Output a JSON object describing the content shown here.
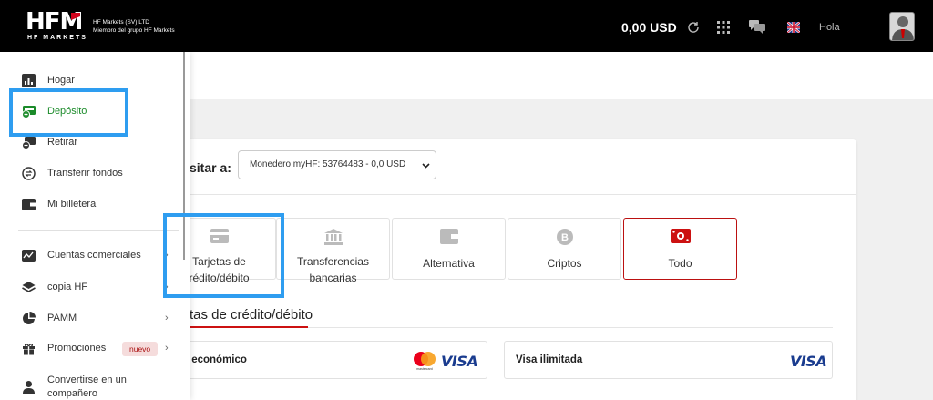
{
  "header": {
    "logo_text": "HFM",
    "logo_subtext": "HF MARKETS",
    "company_line1": "HF Markets (SV) LTD",
    "company_line2": "Miembro del grupo HF Markets",
    "balance": "0,00 USD",
    "greeting": "Hola"
  },
  "sidebar": {
    "items": [
      {
        "label": "Hogar",
        "icon": "chart-icon"
      },
      {
        "label": "Depósito",
        "icon": "deposit-icon"
      },
      {
        "label": "Retirar",
        "icon": "withdraw-icon"
      },
      {
        "label": "Transferir fondos",
        "icon": "transfer-icon"
      },
      {
        "label": "Mi billetera",
        "icon": "wallet-icon"
      },
      {
        "label": "Cuentas comerciales",
        "icon": "trading-accounts-icon"
      },
      {
        "label": "copia HF",
        "icon": "layers-icon"
      },
      {
        "label": "PAMM",
        "icon": "pie-icon"
      },
      {
        "label": "Promociones",
        "icon": "gift-icon",
        "badge": "nuevo"
      },
      {
        "label_line1": "Convertirse en un",
        "label_line2": "compañero",
        "icon": "partner-icon"
      }
    ]
  },
  "deposit": {
    "label": "sitar a:",
    "wallet_value": "Monedero myHF: 53764483 - 0,0 USD"
  },
  "methods": [
    {
      "line1": "Tarjetas de",
      "line2": "rédito/débito"
    },
    {
      "line1": "Transferencias",
      "line2": "bancarias"
    },
    {
      "line1": "Alternativa"
    },
    {
      "line1": "Criptos"
    },
    {
      "line1": "Todo"
    }
  ],
  "section": {
    "title": "tas de crédito/débito"
  },
  "card_options": [
    {
      "label": "o económico",
      "brand": "VISA",
      "brand2": "mastercard"
    },
    {
      "label": "Visa ilimitada",
      "brand": "VISA"
    }
  ],
  "colors": {
    "accent_green": "#1b8b2a",
    "accent_red": "#cc1111",
    "highlight_blue": "#2e9df0"
  }
}
